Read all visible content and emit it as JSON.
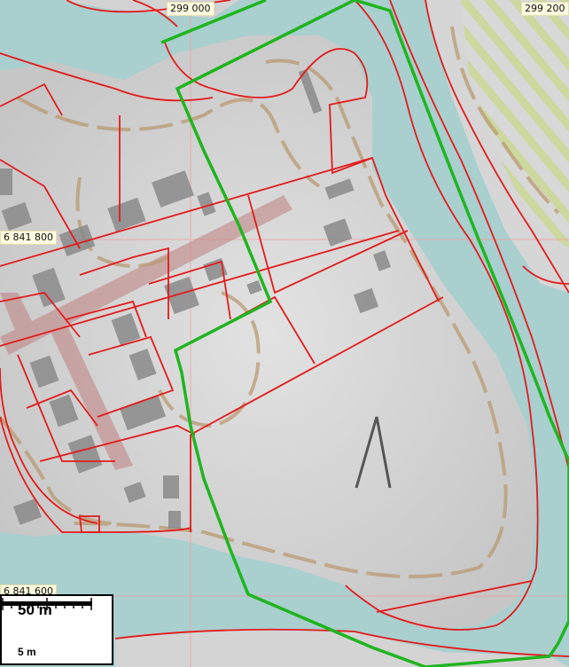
{
  "map": {
    "coordinates": {
      "x_left": "299 000",
      "x_right": "299 200",
      "y_upper": "6 841 800",
      "y_lower": "6 841 600"
    },
    "scale": {
      "main_label": "50 m",
      "minor_label": "5 m"
    },
    "colors": {
      "water": "#a9cfcf",
      "land": "#d8d8d8",
      "property_line": "#e31b1b",
      "boundary": "#1fb51f",
      "contour": "#b99a72",
      "building": "#8a8a8a",
      "road": "#c08080",
      "grid": "#f0a0a0",
      "hatch": "#c8d88a"
    },
    "icons": {
      "north_arrow": "north-arrow-icon"
    }
  }
}
